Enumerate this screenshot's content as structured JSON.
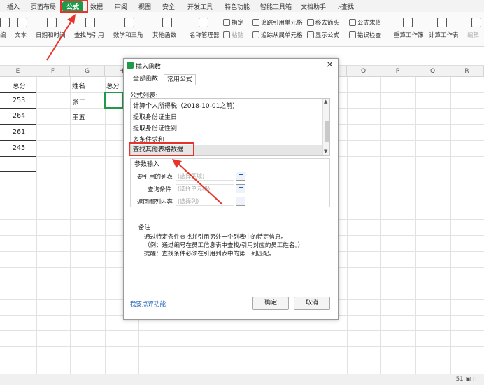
{
  "menu": {
    "items": [
      "插入",
      "页面布局",
      "公式",
      "数据",
      "审阅",
      "视图",
      "安全",
      "开发工具",
      "特色功能",
      "智能工具箱",
      "文档助手"
    ],
    "active": "公式",
    "search_label": "查找"
  },
  "ribbon": {
    "groups": [
      "编",
      "文本",
      "日期和时间",
      "查找与引用",
      "数学和三角",
      "其他函数",
      "名称管理器",
      "重算工作簿",
      "计算工作表",
      "编辑"
    ],
    "define_label": "指定",
    "paste_label": "粘贴",
    "trace_precedents": "追踪引用单元格",
    "trace_dependents": "追踪从属单元格",
    "remove_arrows": "移去箭头",
    "show_formulas": "显示公式",
    "evaluate_formula": "公式求值",
    "error_checking": "错误检查"
  },
  "sheet": {
    "columns": [
      "E",
      "F",
      "G",
      "H",
      "O",
      "P",
      "Q",
      "R"
    ],
    "e_col": [
      "总分",
      "253",
      "264",
      "261",
      "245"
    ],
    "g_col": [
      "姓名",
      "张三",
      "王五"
    ],
    "h_header": "总分"
  },
  "dialog": {
    "title": "插入函数",
    "tabs": [
      "全部函数",
      "常用公式"
    ],
    "active_tab": "常用公式",
    "list_label": "公式列表:",
    "formulas": [
      "计算个人所得税（2018-10-01之前）",
      "提取身份证生日",
      "提取身份证性别",
      "多条件求和",
      "查找其他表格数据"
    ],
    "selected_formula": "查找其他表格数据",
    "params_label": "参数输入",
    "params": [
      {
        "label": "要引用的列表",
        "placeholder": "(选择区域)"
      },
      {
        "label": "查询条件",
        "placeholder": "(选择单元格)"
      },
      {
        "label": "返回哪列内容",
        "placeholder": "(选择列)"
      }
    ],
    "note_title": "备注",
    "note_lines": [
      "通过特定条件查找并引用另外一个列表中的特定信息。",
      "（例：通过编号在员工信息表中查找/引用对应的员工姓名。）",
      "提醒：查找条件必须在引用列表中的第一列匹配。"
    ],
    "feedback_link": "我要点评功能",
    "ok_label": "确定",
    "cancel_label": "取消"
  },
  "status": {
    "right_text": "51 ▣ ◫"
  },
  "colors": {
    "accent": "#1f9a4a",
    "highlight": "#e8332a"
  }
}
